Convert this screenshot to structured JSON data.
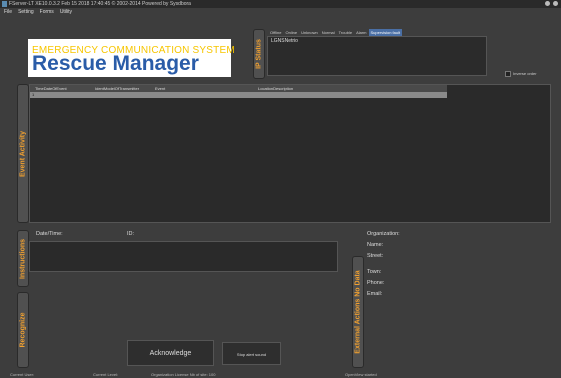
{
  "window": {
    "title": "FServer-LT  XE10.0.3.2  Feb 15 2018 17:40:45  © 2002-2014  Powered by Sysdbora"
  },
  "menu": [
    "File",
    "Setting",
    "Forms",
    "Utility"
  ],
  "logo": {
    "line1": "EMERGENCY COMMUNICATION SYSTEM",
    "line2": "Rescue Manager"
  },
  "ip_status": {
    "tab_label": "IP Status",
    "filters": [
      "Offline",
      "Online",
      "Unknown",
      "Normal",
      "Trouble",
      "Alarm",
      "Supervision fault"
    ],
    "selected_filter": "Supervision fault",
    "content_text": "LGNSNetrio"
  },
  "inverse_order_label": "Inverse order",
  "event_activity": {
    "tab_label": "Event Activity",
    "columns": [
      "TimeDateOfEvent",
      "IdentModelOfTransmitter",
      "Event",
      "LocationDescription"
    ],
    "selected_row_marker": "1"
  },
  "instructions": {
    "tab_label": "Instructions",
    "datetime_label": "Date/Time:",
    "id_label": "ID:"
  },
  "recognize": {
    "tab_label": "Recognize",
    "acknowledge_label": "Acknowledge",
    "stop_sound_label": "Stop alert sound"
  },
  "external": {
    "tab_label": "External Actions No Data",
    "fields": [
      "Organization:",
      "Name:",
      "Street:",
      "Town:",
      "Phone:",
      "Email:"
    ]
  },
  "statusbar": {
    "items": [
      "Current User:",
      "Current Level:",
      "Organization License Nb of site: 100",
      "OpenView started"
    ]
  },
  "colors": {
    "accent": "#f0a030",
    "selection": "#4a6fa5",
    "logo_yellow": "#f7c600",
    "logo_blue": "#2a5ca8"
  }
}
